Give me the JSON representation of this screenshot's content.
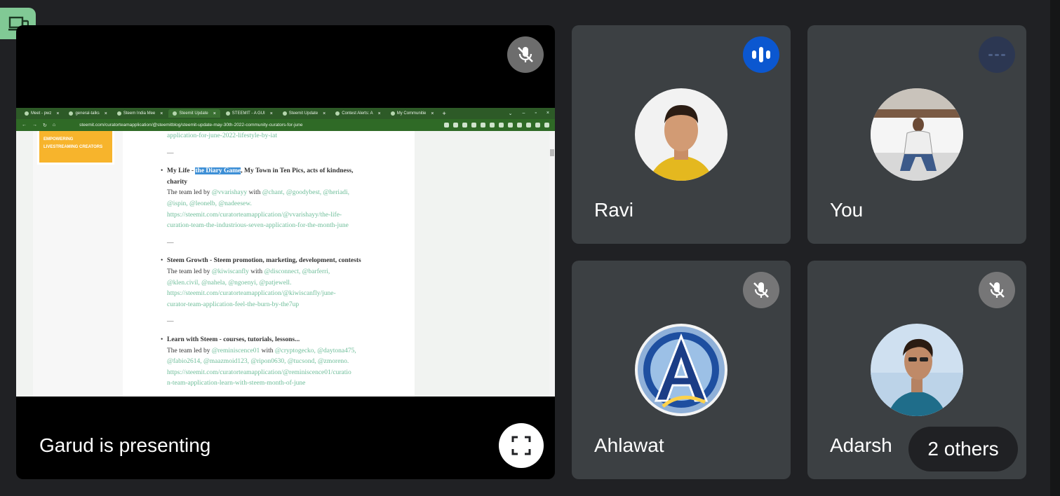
{
  "presenter": {
    "label": "Garud is presenting"
  },
  "shared_screen": {
    "tabs": [
      {
        "label": "Meet - pwz"
      },
      {
        "label": "general-talks"
      },
      {
        "label": "Steem India Mee"
      },
      {
        "label": "Steemit Update"
      },
      {
        "label": "STEEMIT - A GUI"
      },
      {
        "label": "Steemit Update"
      },
      {
        "label": "Contest Alerts: A"
      },
      {
        "label": "My Communitie"
      }
    ],
    "url": "steemit.com/curatorteamapplication/@steemitblog/steemit-update-may-30th-2022-community-curators-for-june",
    "banner_line1": "EMPOWERING",
    "banner_line2": "LIVESTREAMING CREATORS",
    "article": {
      "top_link": "application-for-june-2022-lifestyle-by-iat",
      "sep": "—",
      "item1": {
        "title_pre": "My Life - ",
        "title_hl": "the Diary Game",
        "title_post": ", My Town in Ten Pics, acts of kindness,",
        "title_line2": "charity",
        "led_pre": "The team led by ",
        "leader": "@vvarishayy",
        "with": " with ",
        "members1": "@chant, @goodybest, @heriadi,",
        "members2": "@ispin, @leonelb, @nadeesew.",
        "link1": "https://steemit.com/curatorteamapplication/@vvarishayy/the-life-",
        "link2": "curation-team-the-industrious-seven-application-for-the-month-june"
      },
      "item2": {
        "title": "Steem Growth - Steem promotion, marketing, development, contests",
        "led_pre": "The team led by ",
        "leader": "@kiwiscanfly",
        "with": " with ",
        "members1": "@disconnect, @barferri,",
        "members2": "@klen.civil, @nahela, @ngoenyi, @patjewell.",
        "link1": "https://steemit.com/curatorteamapplication/@kiwiscanfly/june-",
        "link2": "curator-team-application-feel-the-burn-by-the7up"
      },
      "item3": {
        "title": "Learn with Steem - courses, tutorials, lessons...",
        "led_pre": "The team led by ",
        "leader": "@reminiscence01",
        "with": " with ",
        "members1": "@cryptogecko, @daytona475,",
        "members2": "@fabio2614, @maazmoid123, @ripon0630, @tucsond, @zmoreno.",
        "link1": "https://steemit.com/curatorteamapplication/@reminiscence01/curatio",
        "link2": "n-team-application-learn-with-steem-month-of-june"
      }
    }
  },
  "participants": [
    {
      "name": "Ravi",
      "status": "speaking"
    },
    {
      "name": "You",
      "status": "idle"
    },
    {
      "name": "Ahlawat",
      "status": "muted"
    },
    {
      "name": "Adarsh",
      "status": "muted"
    }
  ],
  "others": {
    "label": "2 others"
  },
  "colors": {
    "background": "#202124",
    "tile": "#3c4043",
    "speaking": "#0b57d0",
    "pip_badge": "#81c995",
    "browser_chrome": "#2d5a27"
  }
}
